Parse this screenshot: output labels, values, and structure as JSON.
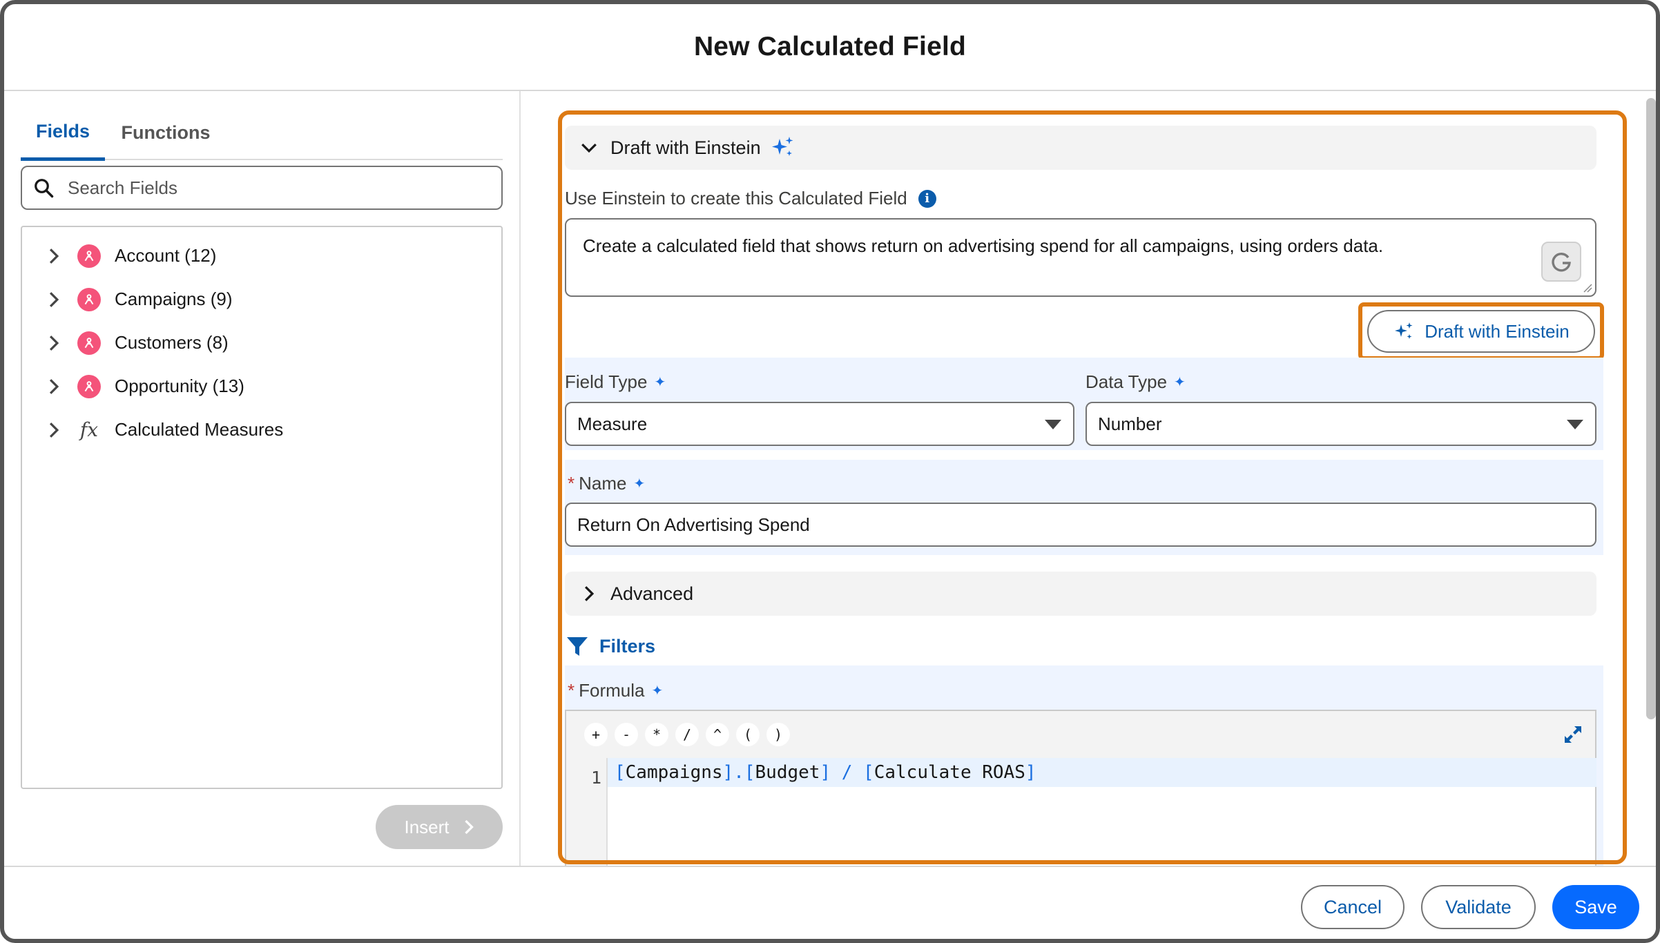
{
  "modal": {
    "title": "New Calculated Field"
  },
  "left": {
    "tabs": [
      {
        "label": "Fields"
      },
      {
        "label": "Functions"
      }
    ],
    "search": {
      "placeholder": "Search Fields"
    },
    "tree": [
      {
        "label": "Account (12)",
        "icon": "object-icon"
      },
      {
        "label": "Campaigns (9)",
        "icon": "object-icon"
      },
      {
        "label": "Customers (8)",
        "icon": "object-icon"
      },
      {
        "label": "Opportunity (13)",
        "icon": "object-icon"
      },
      {
        "label": "Calculated Measures",
        "icon": "fx-icon",
        "icon_text": "fx"
      }
    ],
    "insert_label": "Insert"
  },
  "draft": {
    "section_label": "Draft with Einstein",
    "prompt_label": "Use Einstein to create this Calculated Field",
    "info_glyph": "i",
    "prompt_text": "Create a calculated field that shows return on advertising spend for all campaigns, using orders data.",
    "button_label": "Draft with Einstein"
  },
  "fields": {
    "field_type": {
      "label": "Field Type",
      "value": "Measure"
    },
    "data_type": {
      "label": "Data Type",
      "value": "Number"
    },
    "name": {
      "required_mark": "*",
      "label": "Name",
      "value": "Return On Advertising Spend"
    },
    "ai_star": "✦"
  },
  "advanced": {
    "label": "Advanced"
  },
  "filters": {
    "label": "Filters"
  },
  "formula": {
    "required_mark": "*",
    "label": "Formula",
    "operators": [
      "+",
      "-",
      "*",
      "/",
      "^",
      "(",
      ")"
    ],
    "line_number": "1",
    "tokens": [
      {
        "text": "[",
        "kind": "brk"
      },
      {
        "text": "Campaigns",
        "kind": "txt"
      },
      {
        "text": "].[",
        "kind": "brk"
      },
      {
        "text": "Budget",
        "kind": "txt"
      },
      {
        "text": "] / [",
        "kind": "brk"
      },
      {
        "text": "Calculate ROAS",
        "kind": "txt"
      },
      {
        "text": "]",
        "kind": "brk"
      }
    ]
  },
  "footer": {
    "cancel": "Cancel",
    "validate": "Validate",
    "save": "Save"
  },
  "colors": {
    "accent": "#0b5cab",
    "highlight": "#dd7a13",
    "object_icon": "#f4537a",
    "save": "#066afe"
  }
}
